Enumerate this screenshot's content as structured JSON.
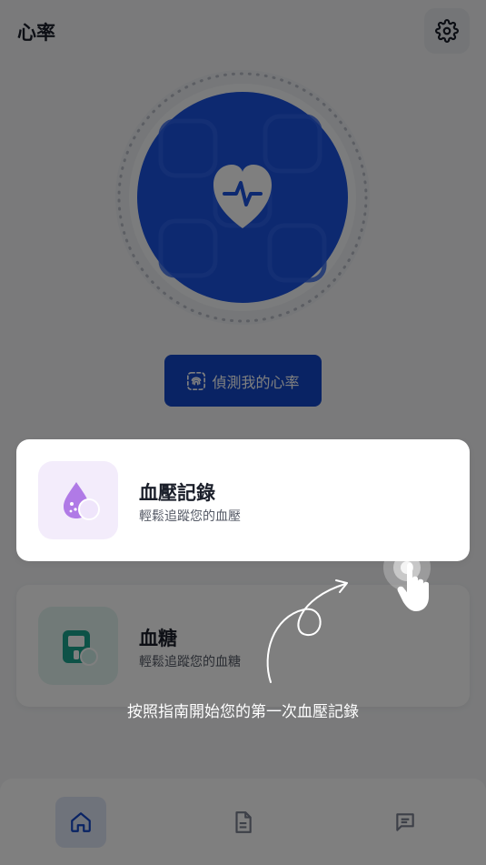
{
  "header": {
    "title": "心率"
  },
  "hero": {
    "icon": "heart-pulse-icon"
  },
  "detect_button": {
    "label": "偵測我的心率",
    "icon": "fingerprint-icon"
  },
  "cards": [
    {
      "title": "血壓記錄",
      "subtitle": "輕鬆追蹤您的血壓",
      "icon": "blood-drop-icon",
      "accent": "#b07ae6",
      "bg": "#f3ecfb"
    },
    {
      "title": "血糖",
      "subtitle": "輕鬆追蹤您的血糖",
      "icon": "glucose-meter-icon",
      "accent": "#1aa58e",
      "bg": "#e2f4f1"
    }
  ],
  "coachmark": {
    "text": "按照指南開始您的第一次血壓記錄"
  },
  "nav": [
    {
      "icon": "home-icon",
      "active": true
    },
    {
      "icon": "document-icon",
      "active": false
    },
    {
      "icon": "chat-icon",
      "active": false
    }
  ],
  "colors": {
    "primary": "#1247c8",
    "background": "#f4f5f7",
    "overlay": "rgba(0,0,0,0.5)"
  }
}
